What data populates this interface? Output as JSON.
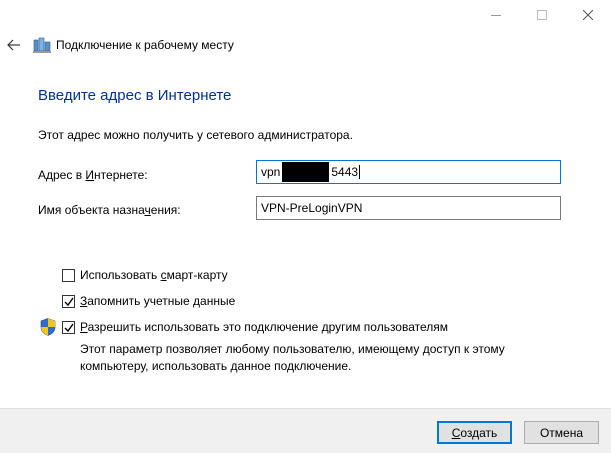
{
  "window": {
    "title": "Подключение к рабочему месту",
    "controls": [
      "minimize",
      "maximize",
      "close"
    ]
  },
  "heading": "Введите адрес в Интернете",
  "hint": "Этот адрес можно получить у сетевого администратора.",
  "fields": {
    "address": {
      "label_pre": "Адрес в ",
      "label_accel": "И",
      "label_post": "нтернете:",
      "value_prefix": "vpn",
      "value_suffix": "5443"
    },
    "destination": {
      "label_pre": "Имя объекта назна",
      "label_accel": "ч",
      "label_post": "ения:",
      "value": "VPN-PreLoginVPN"
    }
  },
  "options": [
    {
      "label_pre": "Использовать ",
      "label_accel": "с",
      "label_post": "март-карту",
      "checked": false
    },
    {
      "label_pre": "",
      "label_accel": "З",
      "label_post": "апомнить учетные данные",
      "checked": true
    },
    {
      "label_pre": "",
      "label_accel": "Р",
      "label_post": "азрешить использовать это подключение другим пользователям",
      "checked": true
    }
  ],
  "shared_description": "Этот параметр позволяет любому пользователю, имеющему доступ к этому компьютеру, использовать данное подключение.",
  "buttons": {
    "create": {
      "label_pre": "",
      "label_accel": "С",
      "label_post": "оздать"
    },
    "cancel": {
      "label": "Отмена"
    }
  },
  "colors": {
    "heading": "#003399",
    "focus_border": "#0078d7",
    "footer_bg": "#f0f0f0"
  }
}
